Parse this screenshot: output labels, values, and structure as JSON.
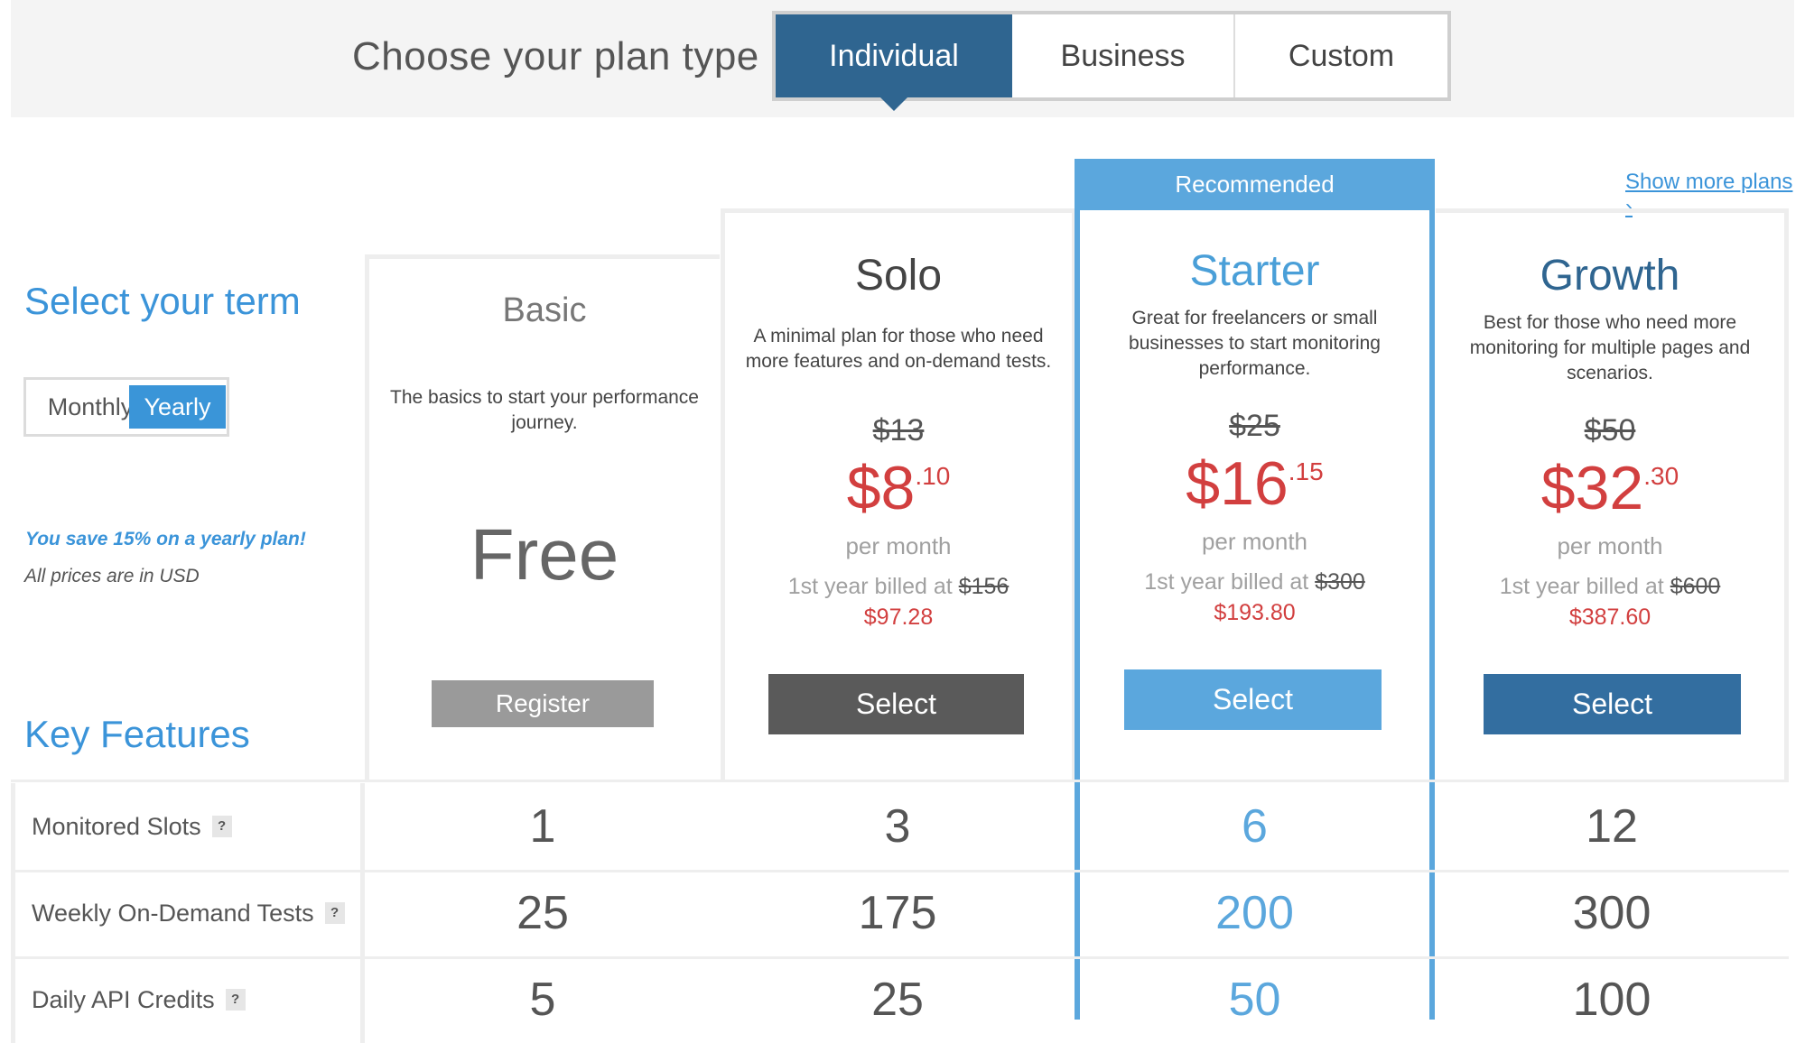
{
  "header": {
    "plan_type_label": "Choose your plan type",
    "tabs": [
      "Individual",
      "Business",
      "Custom"
    ],
    "active_tab": "Individual"
  },
  "term": {
    "heading": "Select your term",
    "monthly": "Monthly",
    "yearly": "Yearly",
    "selected": "Yearly",
    "save_note": "You save 15% on a yearly plan!",
    "usd_note": "All prices are in USD"
  },
  "key_features_heading": "Key Features",
  "recommended_label": "Recommended",
  "show_more": "Show more plans ›",
  "plans": {
    "basic": {
      "name": "Basic",
      "description": "The basics to start your performance journey.",
      "price_text": "Free",
      "button": "Register"
    },
    "solo": {
      "name": "Solo",
      "description": "A minimal plan for those who need more features and on-demand tests.",
      "original_price": "$13",
      "price_main": "$8",
      "price_cents": ".10",
      "per_month": "per month",
      "billed_prefix": "1st year billed at",
      "billed_original": "$156",
      "billed_new": "$97.28",
      "button": "Select"
    },
    "starter": {
      "name": "Starter",
      "description": "Great for freelancers or small businesses to start monitoring performance.",
      "original_price": "$25",
      "price_main": "$16",
      "price_cents": ".15",
      "per_month": "per month",
      "billed_prefix": "1st year billed at",
      "billed_original": "$300",
      "billed_new": "$193.80",
      "button": "Select"
    },
    "growth": {
      "name": "Growth",
      "description": "Best for those who need more monitoring for multiple pages and scenarios.",
      "original_price": "$50",
      "price_main": "$32",
      "price_cents": ".30",
      "per_month": "per month",
      "billed_prefix": "1st year billed at",
      "billed_original": "$600",
      "billed_new": "$387.60",
      "button": "Select"
    }
  },
  "features": [
    {
      "label": "Monitored Slots",
      "help": "?",
      "basic": "1",
      "solo": "3",
      "starter": "6",
      "growth": "12"
    },
    {
      "label": "Weekly On-Demand Tests",
      "help": "?",
      "basic": "25",
      "solo": "175",
      "starter": "200",
      "growth": "300"
    },
    {
      "label": "Daily API Credits",
      "help": "?",
      "basic": "5",
      "solo": "25",
      "starter": "50",
      "growth": "100"
    }
  ],
  "colors": {
    "tab_active": "#2f6590",
    "accent_blue": "#3b94d9",
    "starter_blue": "#5ba7dd",
    "price_red": "#d23f3f",
    "solo_button": "#5a5a5a",
    "basic_button": "#9a9a9a",
    "growth_button": "#336ea0"
  }
}
